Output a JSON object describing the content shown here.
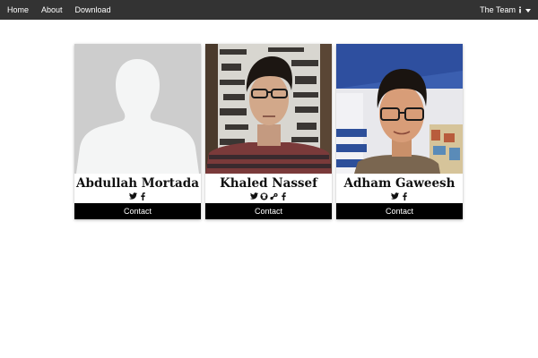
{
  "nav": {
    "links": [
      "Home",
      "About",
      "Download"
    ],
    "team_label": "The Team"
  },
  "team": [
    {
      "name": "Abdullah Mortada",
      "socials": [
        "twitter-icon",
        "facebook-icon"
      ],
      "contact_label": "Contact",
      "photo": "placeholder-silhouette"
    },
    {
      "name": "Khaled Nassef",
      "socials": [
        "twitter-icon",
        "github-icon",
        "steam-icon",
        "facebook-icon"
      ],
      "contact_label": "Contact",
      "photo": "portrait"
    },
    {
      "name": "Adham Gaweesh",
      "socials": [
        "twitter-icon",
        "facebook-icon"
      ],
      "contact_label": "Contact",
      "photo": "portrait"
    }
  ],
  "colors": {
    "navbar_bg": "#333333",
    "contact_bg": "#000000",
    "text": "#111111"
  }
}
